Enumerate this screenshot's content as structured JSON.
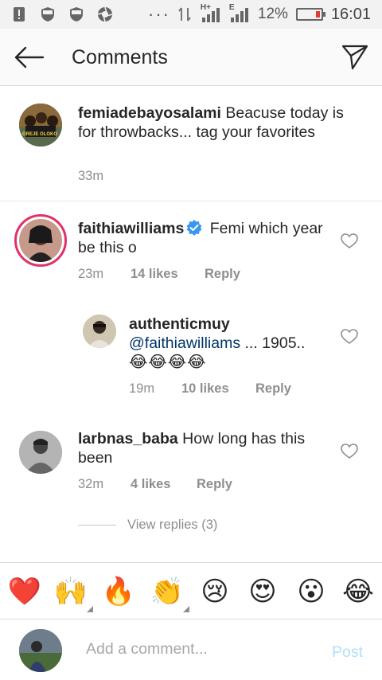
{
  "status_bar": {
    "signal_label": "H+",
    "signal_label_2": "E",
    "battery_percent": "12%",
    "time": "16:01",
    "dots": "···"
  },
  "header": {
    "title": "Comments",
    "back_icon": "arrow-left-icon",
    "send_icon": "paper-plane-icon"
  },
  "caption": {
    "username": "femiadebayosalami",
    "text": " Beacuse today is for throwbacks... tag your favorites",
    "time": "33m",
    "avatar_text": "GREJE OLOKO"
  },
  "comments": [
    {
      "username": "faithiawilliams",
      "verified": true,
      "text": " Femi which year be this o",
      "time": "23m",
      "likes": "14 likes",
      "reply": "Reply"
    },
    {
      "username": "authenticmuy",
      "mention": "@faithiawilliams",
      "text": " ... 1905..",
      "emojis": "😂😂😂😂",
      "time": "19m",
      "likes": "10 likes",
      "reply": "Reply"
    },
    {
      "username": "larbnas_baba",
      "text": " How long has this been",
      "time": "32m",
      "likes": "4 likes",
      "reply": "Reply"
    }
  ],
  "view_replies": "View replies (3)",
  "emoji_bar": [
    "❤️",
    "🙌",
    "🔥",
    "👏",
    "😢",
    "😍",
    "😮",
    "😂"
  ],
  "composer": {
    "placeholder": "Add a comment...",
    "post_label": "Post"
  },
  "colors": {
    "accent_blue": "#3897f0",
    "post_disabled": "#b2dffc",
    "meta_gray": "#8e8e8e",
    "story_ring": "#e1306c"
  }
}
